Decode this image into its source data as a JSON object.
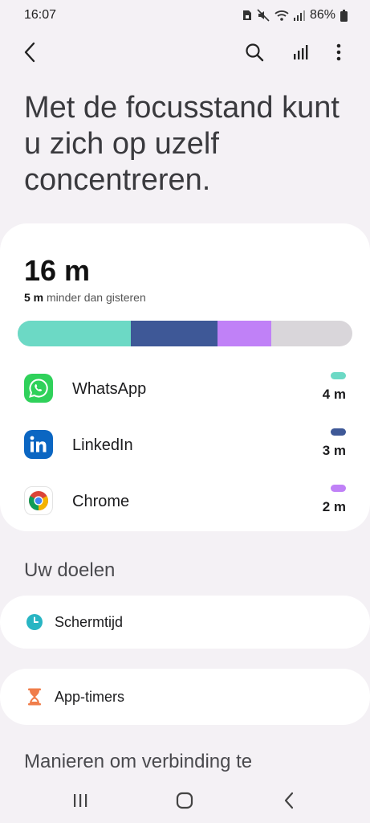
{
  "status_bar": {
    "time": "16:07",
    "battery": "86%",
    "icons": [
      "sim-lock-icon",
      "mute-icon",
      "wifi-icon",
      "signal-icon",
      "battery-icon"
    ]
  },
  "app_bar": {
    "icons": [
      "back-icon",
      "search-icon",
      "stats-icon",
      "more-icon"
    ]
  },
  "headline": "Met de focusstand kunt u zich op uzelf concentreren.",
  "usage": {
    "total": "16 m",
    "compare_value": "5 m",
    "compare_text": " minder dan gisteren",
    "bar_segments": [
      {
        "app": "WhatsApp",
        "fraction": 0.339,
        "color": "#6cd9c5"
      },
      {
        "app": "LinkedIn",
        "fraction": 0.258,
        "color": "#3e5897"
      },
      {
        "app": "Chrome",
        "fraction": 0.16,
        "color": "#c081f7"
      }
    ],
    "bar_rest_color": "#d9d6da",
    "apps": [
      {
        "name": "WhatsApp",
        "time": "4 m",
        "color": "#6cd9c5",
        "icon": "whatsapp-icon"
      },
      {
        "name": "LinkedIn",
        "time": "3 m",
        "color": "#3e5897",
        "icon": "linkedin-icon"
      },
      {
        "name": "Chrome",
        "time": "2 m",
        "color": "#c081f7",
        "icon": "chrome-icon"
      }
    ]
  },
  "goals": {
    "title": "Uw doelen",
    "items": [
      {
        "label": "Schermtijd",
        "icon": "clock-icon"
      },
      {
        "label": "App-timers",
        "icon": "hourglass-icon"
      }
    ]
  },
  "connect_title": "Manieren om verbinding te",
  "nav_bar": {
    "icons": [
      "recents-icon",
      "home-icon",
      "back-nav-icon"
    ]
  }
}
